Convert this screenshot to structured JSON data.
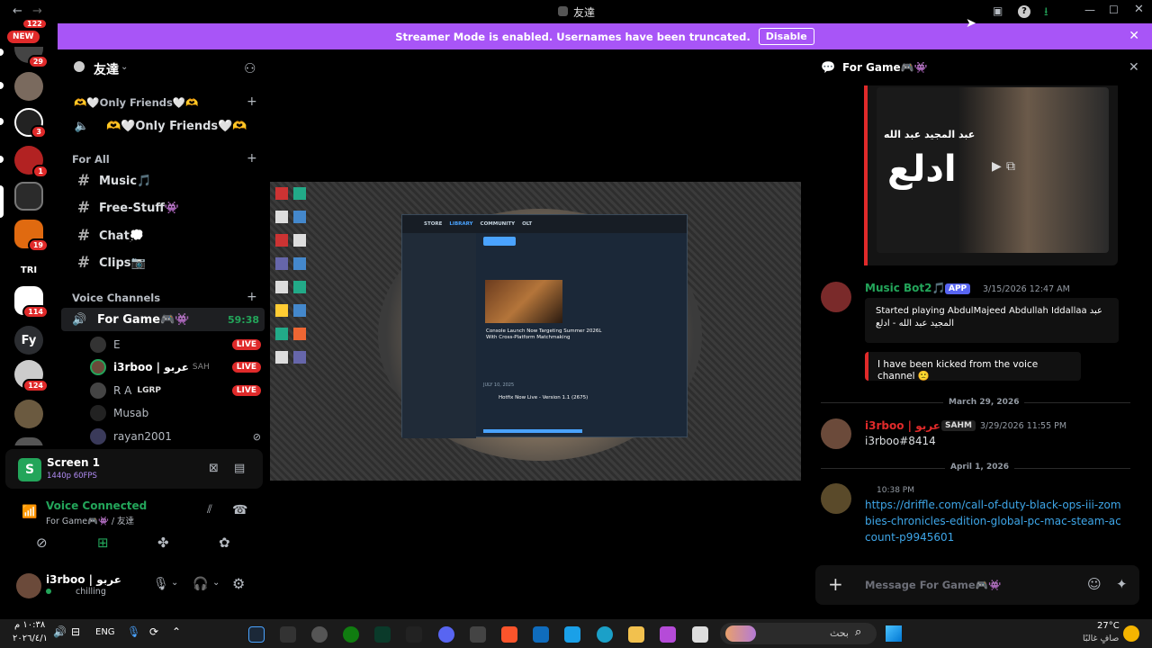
{
  "window": {
    "title": "友達"
  },
  "banner": {
    "text": "Streamer Mode is enabled. Usernames have been truncated.",
    "disable_label": "Disable"
  },
  "rail": {
    "new_label": "NEW",
    "top_badge": "122",
    "badges": [
      "29",
      "3",
      "1",
      "19",
      "114",
      "124"
    ],
    "text_servers": [
      "TRI",
      "Fy"
    ]
  },
  "server": {
    "name": "友達",
    "channels_top": [
      {
        "label": "🫶🤍Only Friends🤍🫶"
      },
      {
        "label": "🫶🤍Only Friends🤍🫶"
      }
    ],
    "for_all_label": "For All",
    "text_channels": [
      "Music🎵",
      "Free-Stuff👾",
      "Chat💭",
      "Clips📷"
    ],
    "voice_label": "Voice Channels",
    "voice_channel": {
      "name": "For Game🎮👾",
      "timer": "59:38"
    },
    "voice_users": [
      {
        "name": "E",
        "live": "LIVE"
      },
      {
        "name": "i3rboo | عربو",
        "tag": "SAH",
        "live": "LIVE"
      },
      {
        "name": "R A",
        "tag": "LGRP",
        "live": "LIVE"
      },
      {
        "name": "Musab",
        "live": ""
      },
      {
        "name": "rayan2001",
        "live": ""
      }
    ]
  },
  "screen_share": {
    "title": "Screen 1",
    "quality": "1440p 60FPS"
  },
  "voice": {
    "status": "Voice Connected",
    "location": "For Game🎮👾 / 友達"
  },
  "user": {
    "name": "i3rboo | عربو",
    "status": "chilling"
  },
  "stream": {
    "tabs": [
      "STORE",
      "LIBRARY",
      "COMMUNITY",
      "OLT"
    ],
    "headline1": "Console Launch Now Targeting Summer 2026L With Cross-Platform Matchmaking",
    "headline2": "Hotfix Now Live - Version 1.1 (2675)",
    "date_label": "JULY 10, 2025"
  },
  "chat": {
    "channel": "For Game🎮👾",
    "image_text_small": "عبد المجيد عبد الله",
    "image_text_big": "ادلع",
    "bot": {
      "name": "Music Bot2🎵",
      "app_label": "APP",
      "time": "3/15/2026 12:47 AM",
      "embed_text": "Started playing AbdulMajeed Abdullah Iddallaa عبد المجيد عبد الله - ادلع",
      "kick_text": "I have been kicked from the voice channel 🙁"
    },
    "date1": "March 29, 2026",
    "msg2": {
      "name": "i3rboo | عربو",
      "tag": "SAHM",
      "time": "3/29/2026 11:55 PM",
      "text": "i3rboo#8414"
    },
    "date2": "April 1, 2026",
    "msg3": {
      "time": "10:38 PM",
      "link": "https://driffle.com/call-of-duty-black-ops-iii-zombies-chronicles-edition-global-pc-mac-steam-account-p9945601"
    },
    "placeholder": "Message For Game🎮👾"
  },
  "taskbar": {
    "time": "١٠:٣٨ م",
    "date": "٢٠٢٦/٤/١",
    "lang": "ENG",
    "search_label": "بحث",
    "weather_temp": "27°C",
    "weather_desc": "صافٍ غالبًا"
  },
  "colors": {
    "banner": "#a855f7",
    "live": "#e02a2a",
    "link": "#3ea6e8",
    "green": "#23a55a"
  }
}
